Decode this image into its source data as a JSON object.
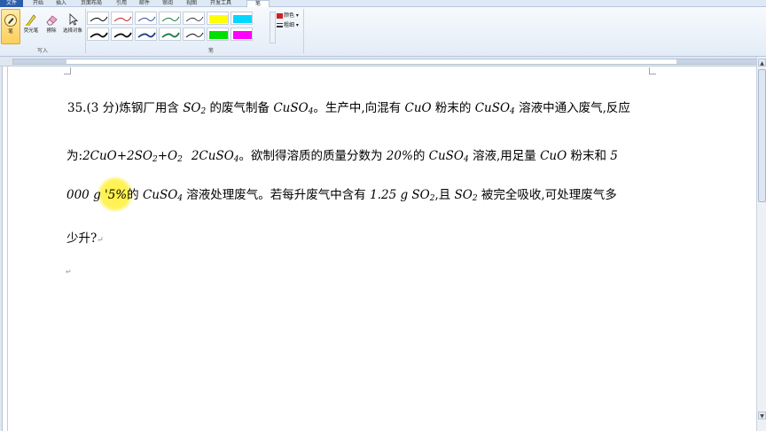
{
  "tabs": [
    "文件",
    "开始",
    "插入",
    "页面布局",
    "引用",
    "邮件",
    "审阅",
    "视图",
    "开发工具",
    "笔"
  ],
  "ribbon": {
    "tools": [
      {
        "label": "笔",
        "icon": "pen-icon"
      },
      {
        "label": "荧光笔",
        "icon": "highlighter-icon"
      },
      {
        "label": "擦除",
        "icon": "eraser-icon"
      },
      {
        "label": "选择对象",
        "icon": "select-objects-icon"
      }
    ],
    "group_write_label": "写入",
    "group_pens_label": "笔",
    "color_label": "颜色",
    "thickness_label": "粗细",
    "pen_colors": [
      "#000000",
      "#cc2222",
      "#2a4fa8",
      "#1f7a3a",
      "#000000",
      "#ffff00",
      "#00d8ff",
      "#111111",
      "#111111",
      "#1f3d8a",
      "#1a7a4a",
      "#333333",
      "#00e000",
      "#ff00ff"
    ],
    "accent": "#ffcf5a"
  },
  "document": {
    "line1": {
      "t1": "35.(3 分)炼钢厂用含 ",
      "so2_a": "SO",
      "sub_a": "2",
      "t2": " 的废气制备 ",
      "cuso4_a": "CuSO",
      "sub_b": "4",
      "t3": "。生产中,向混有 ",
      "cuo_a": "CuO",
      "t4": " 粉末的 ",
      "cuso4_b": "CuSO",
      "sub_c": "4",
      "t5": " 溶液中通入废气,反应"
    },
    "line2": {
      "t1": "为:",
      "eq1": "2CuO+2SO",
      "sub_a": "2",
      "eq2": "+O",
      "sub_b": "2",
      "eq3": "2CuSO",
      "sub_c": "4",
      "t2": "。欲制得溶质的质量分数为 ",
      "pct": "20%",
      "t3": "的 ",
      "cuso4": "CuSO",
      "sub_d": "4",
      "t4": " 溶液,用足量 ",
      "cuo": "CuO",
      "t5": " 粉末和 ",
      "num": "5"
    },
    "line3": {
      "t1": "000 ",
      "g": "g",
      "t2": " '5%",
      "t3": "的 ",
      "cuso4": "CuSO",
      "sub_a": "4",
      "t4": " 溶液处理废气。若每升废气中含有 ",
      "val": "1.25 g SO",
      "sub_b": "2",
      "t5": ",且 ",
      "so2": "SO",
      "sub_c": "2",
      "t6": " 被完全吸收,可处理废气多"
    },
    "line4": {
      "t1": "少升?"
    },
    "para_mark": "↵"
  }
}
